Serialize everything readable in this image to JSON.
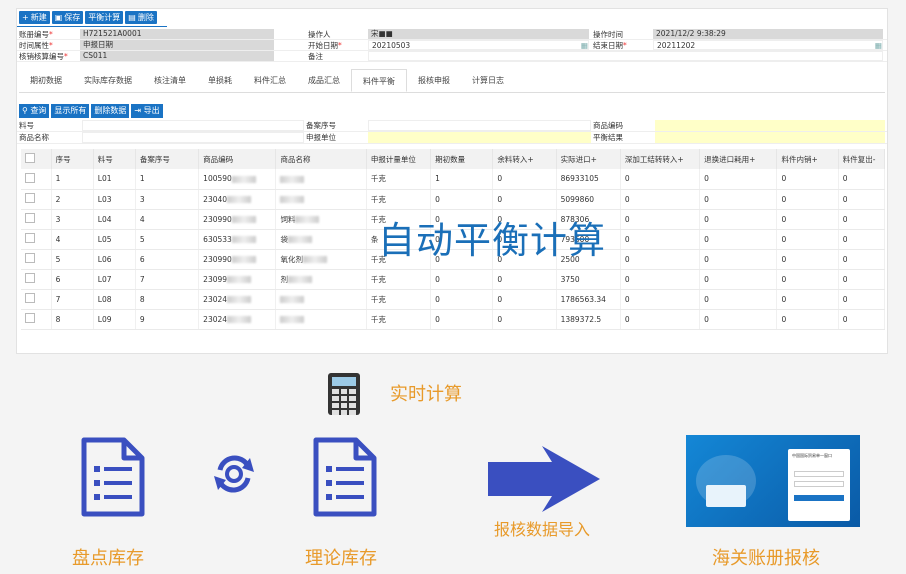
{
  "toolbar": {
    "new_label": "新建",
    "save_label": "保存",
    "balance_label": "平衡计算",
    "delete_label": "删除"
  },
  "form": {
    "account_no_label": "账册编号",
    "account_no_value": "H721521A0001",
    "operator_label": "操作人",
    "operator_value": "宋■■",
    "op_time_label": "操作时间",
    "op_time_value": "2021/12/2 9:38:29",
    "time_attr_label": "时间属性",
    "time_attr_value": "申报日期",
    "start_date_label": "开始日期",
    "start_date_value": "20210503",
    "end_date_label": "结束日期",
    "end_date_value": "20211202",
    "verify_no_label": "核销核算编号",
    "verify_no_value": "CS011",
    "remark_label": "备注",
    "remark_value": ""
  },
  "tabs": [
    "期初数据",
    "实际库存数据",
    "核注清单",
    "单损耗",
    "料件汇总",
    "成品汇总",
    "料件平衡",
    "报核申报",
    "计算日志"
  ],
  "active_tab_index": 6,
  "query_toolbar": {
    "query_label": "查询",
    "show_all_label": "显示所有",
    "delete_data_label": "删除数据",
    "export_label": "导出"
  },
  "query_form": {
    "item_no_label": "料号",
    "record_no_label": "备案序号",
    "goods_code_label": "商品编码",
    "goods_name_label": "商品名称",
    "declare_unit_label": "申报单位",
    "balance_result_label": "平衡结果"
  },
  "table": {
    "headers": [
      "序号",
      "料号",
      "备案序号",
      "商品编码",
      "商品名称",
      "申报计量单位",
      "期初数量",
      "余料转入+",
      "实际进口+",
      "深加工结转转入+",
      "退换进口耗用+",
      "料件内销+",
      "料件复出-"
    ],
    "rows": [
      [
        "1",
        "L01",
        "1",
        "100590",
        "",
        "千克",
        "1",
        "0",
        "86933105",
        "0",
        "0",
        "0",
        "0"
      ],
      [
        "2",
        "L03",
        "3",
        "23040",
        "",
        "千克",
        "0",
        "0",
        "5099860",
        "0",
        "0",
        "0",
        "0"
      ],
      [
        "3",
        "L04",
        "4",
        "230990",
        "饲料",
        "千克",
        "0",
        "0",
        "878306",
        "0",
        "0",
        "0",
        "0"
      ],
      [
        "4",
        "L05",
        "5",
        "630533",
        "袋",
        "条",
        "0",
        "0",
        "793600",
        "0",
        "0",
        "0",
        "0"
      ],
      [
        "5",
        "L06",
        "6",
        "230990",
        "氧化剂",
        "千克",
        "0",
        "0",
        "2500",
        "0",
        "0",
        "0",
        "0"
      ],
      [
        "6",
        "L07",
        "7",
        "23099",
        "剂",
        "千克",
        "0",
        "0",
        "3750",
        "0",
        "0",
        "0",
        "0"
      ],
      [
        "7",
        "L08",
        "8",
        "23024",
        "",
        "千克",
        "0",
        "0",
        "1786563.34",
        "0",
        "0",
        "0",
        "0"
      ],
      [
        "8",
        "L09",
        "9",
        "23024",
        "",
        "千克",
        "0",
        "0",
        "1389372.5",
        "0",
        "0",
        "0",
        "0"
      ]
    ]
  },
  "overlay_text": "自动平衡计算",
  "flow": {
    "realtime_label": "实时计算",
    "inventory_label": "盘点库存",
    "theory_label": "理论库存",
    "import_label": "报核数据导入",
    "customs_label": "海关账册报核",
    "portal_title": "中国国际贸易单一窗口"
  },
  "colors": {
    "accent": "#1a73c4",
    "icon_blue": "#3a4fc0",
    "orange": "#e89a2a",
    "highlight_yellow": "#ffffc8"
  }
}
